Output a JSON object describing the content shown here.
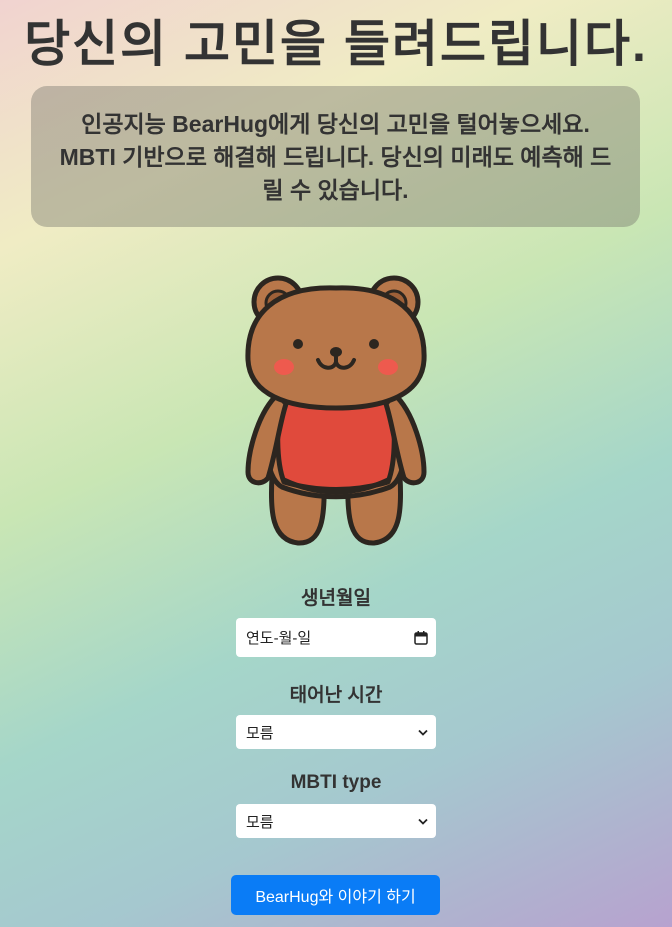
{
  "page": {
    "title": "당신의 고민을 들려드립니다.",
    "intro": "인공지능 BearHug에게 당신의 고민을 털어놓으세요. MBTI 기반으로 해결해 드립니다. 당신의 미래도 예측해 드릴 수 있습니다."
  },
  "mascot": {
    "icon": "bear-mascot-icon",
    "fur_color": "#b8774a",
    "shirt_color": "#e04a3c",
    "cheek_color": "#ee5a4e"
  },
  "form": {
    "birthdate": {
      "label": "생년월일",
      "placeholder": "연도-월-일",
      "icon": "calendar-icon"
    },
    "birth_time": {
      "label": "태어난 시간",
      "selected": "모름",
      "icon": "chevron-down-icon"
    },
    "mbti": {
      "label": "MBTI type",
      "selected": "모름",
      "icon": "chevron-down-icon"
    },
    "submit_label": "BearHug와 이야기 하기"
  },
  "colors": {
    "accent": "#0a7cf6",
    "text": "#333333"
  }
}
